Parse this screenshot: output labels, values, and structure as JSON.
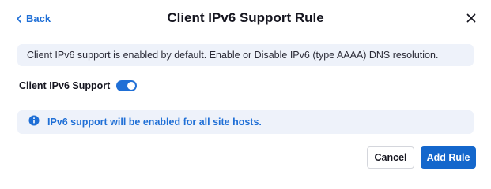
{
  "header": {
    "back_label": "Back",
    "title": "Client IPv6 Support Rule",
    "back_icon": "chevron-left-icon",
    "close_icon": "close-icon"
  },
  "notice": {
    "text": "Client IPv6 support is enabled by default. Enable or Disable IPv6 (type AAAA) DNS resolution."
  },
  "field": {
    "label": "Client IPv6 Support",
    "toggle_on": true
  },
  "info": {
    "icon": "info-icon",
    "text": "IPv6 support will be enabled for all site hosts."
  },
  "actions": {
    "cancel_label": "Cancel",
    "add_label": "Add Rule"
  },
  "colors": {
    "accent": "#1f6fd6",
    "primary_button": "#1467cc",
    "panel_bg": "#eef2fa"
  }
}
